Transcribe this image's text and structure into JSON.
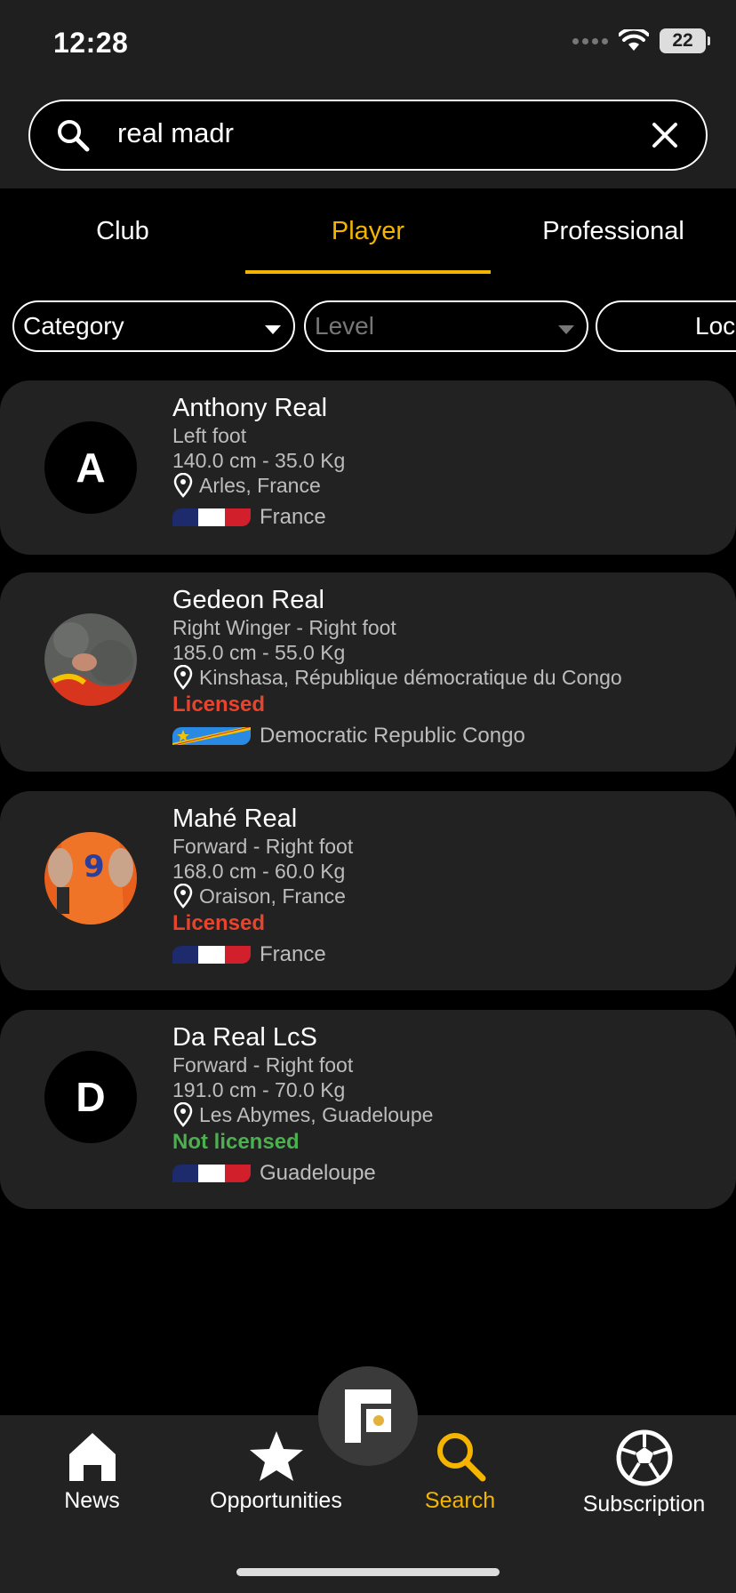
{
  "status_bar": {
    "time": "12:28",
    "battery": "22"
  },
  "search": {
    "value": "real madr"
  },
  "tabs": [
    {
      "label": "Club",
      "active": false
    },
    {
      "label": "Player",
      "active": true
    },
    {
      "label": "Professional",
      "active": false
    }
  ],
  "filters": [
    {
      "label": "Category"
    },
    {
      "label": "Level"
    },
    {
      "label": "Loca"
    }
  ],
  "players": [
    {
      "initial": "A",
      "name": "Anthony Real",
      "position": "Left foot",
      "measures": "140.0 cm - 35.0 Kg",
      "location": "Arles, France",
      "license": "",
      "country": "France"
    },
    {
      "initial": "",
      "name": "Gedeon Real",
      "position": "Right Winger - Right foot",
      "measures": "185.0 cm - 55.0 Kg",
      "location": "Kinshasa, République démocratique du Congo",
      "license": "Licensed",
      "country": "Democratic Republic Congo"
    },
    {
      "initial": "",
      "name": "Mahé Real",
      "position": "Forward - Right foot",
      "measures": "168.0 cm - 60.0 Kg",
      "location": "Oraison, France",
      "license": "Licensed",
      "country": "France"
    },
    {
      "initial": "D",
      "name": "Da Real LcS",
      "position": "Forward - Right foot",
      "measures": "191.0 cm - 70.0 Kg",
      "location": "Les Abymes, Guadeloupe",
      "license": "Not licensed",
      "country": "Guadeloupe"
    }
  ],
  "colors": {
    "accent": "#f5b400",
    "licensed": "#e8432d",
    "not_licensed": "#4caf50",
    "card": "#222222"
  },
  "bottom_nav": [
    {
      "label": "News",
      "icon": "home-icon"
    },
    {
      "label": "Opportunities",
      "icon": "star-icon"
    },
    {
      "label": "Search",
      "icon": "search-icon",
      "active": true
    },
    {
      "label": "Subscription",
      "icon": "soccer-ball-icon"
    }
  ]
}
